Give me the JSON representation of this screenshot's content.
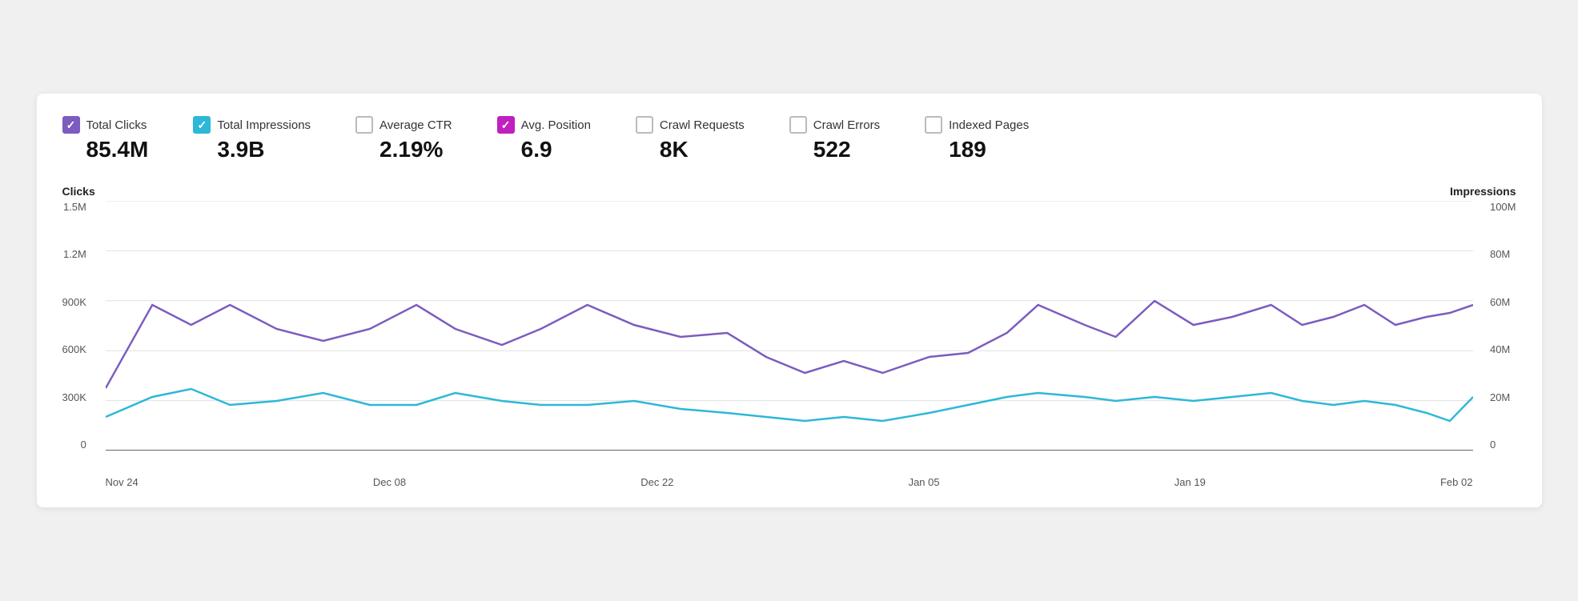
{
  "metrics": [
    {
      "id": "total-clicks",
      "label": "Total Clicks",
      "value": "85.4M",
      "checkbox": "checked-purple"
    },
    {
      "id": "total-impressions",
      "label": "Total Impressions",
      "value": "3.9B",
      "checkbox": "checked-cyan"
    },
    {
      "id": "average-ctr",
      "label": "Average CTR",
      "value": "2.19%",
      "checkbox": "unchecked"
    },
    {
      "id": "avg-position",
      "label": "Avg. Position",
      "value": "6.9",
      "checkbox": "checked-magenta"
    },
    {
      "id": "crawl-requests",
      "label": "Crawl Requests",
      "value": "8K",
      "checkbox": "unchecked"
    },
    {
      "id": "crawl-errors",
      "label": "Crawl Errors",
      "value": "522",
      "checkbox": "unchecked"
    },
    {
      "id": "indexed-pages",
      "label": "Indexed Pages",
      "value": "189",
      "checkbox": "unchecked"
    }
  ],
  "chart": {
    "left_axis_title": "Clicks",
    "right_axis_title": "Impressions",
    "y_labels_left": [
      "0",
      "300K",
      "600K",
      "900K",
      "1.2M",
      "1.5M"
    ],
    "y_labels_right": [
      "0",
      "20M",
      "40M",
      "60M",
      "80M",
      "100M"
    ],
    "x_labels": [
      "Nov 24",
      "Dec 08",
      "Dec 22",
      "Jan 05",
      "Jan 19",
      "Feb 02"
    ]
  }
}
